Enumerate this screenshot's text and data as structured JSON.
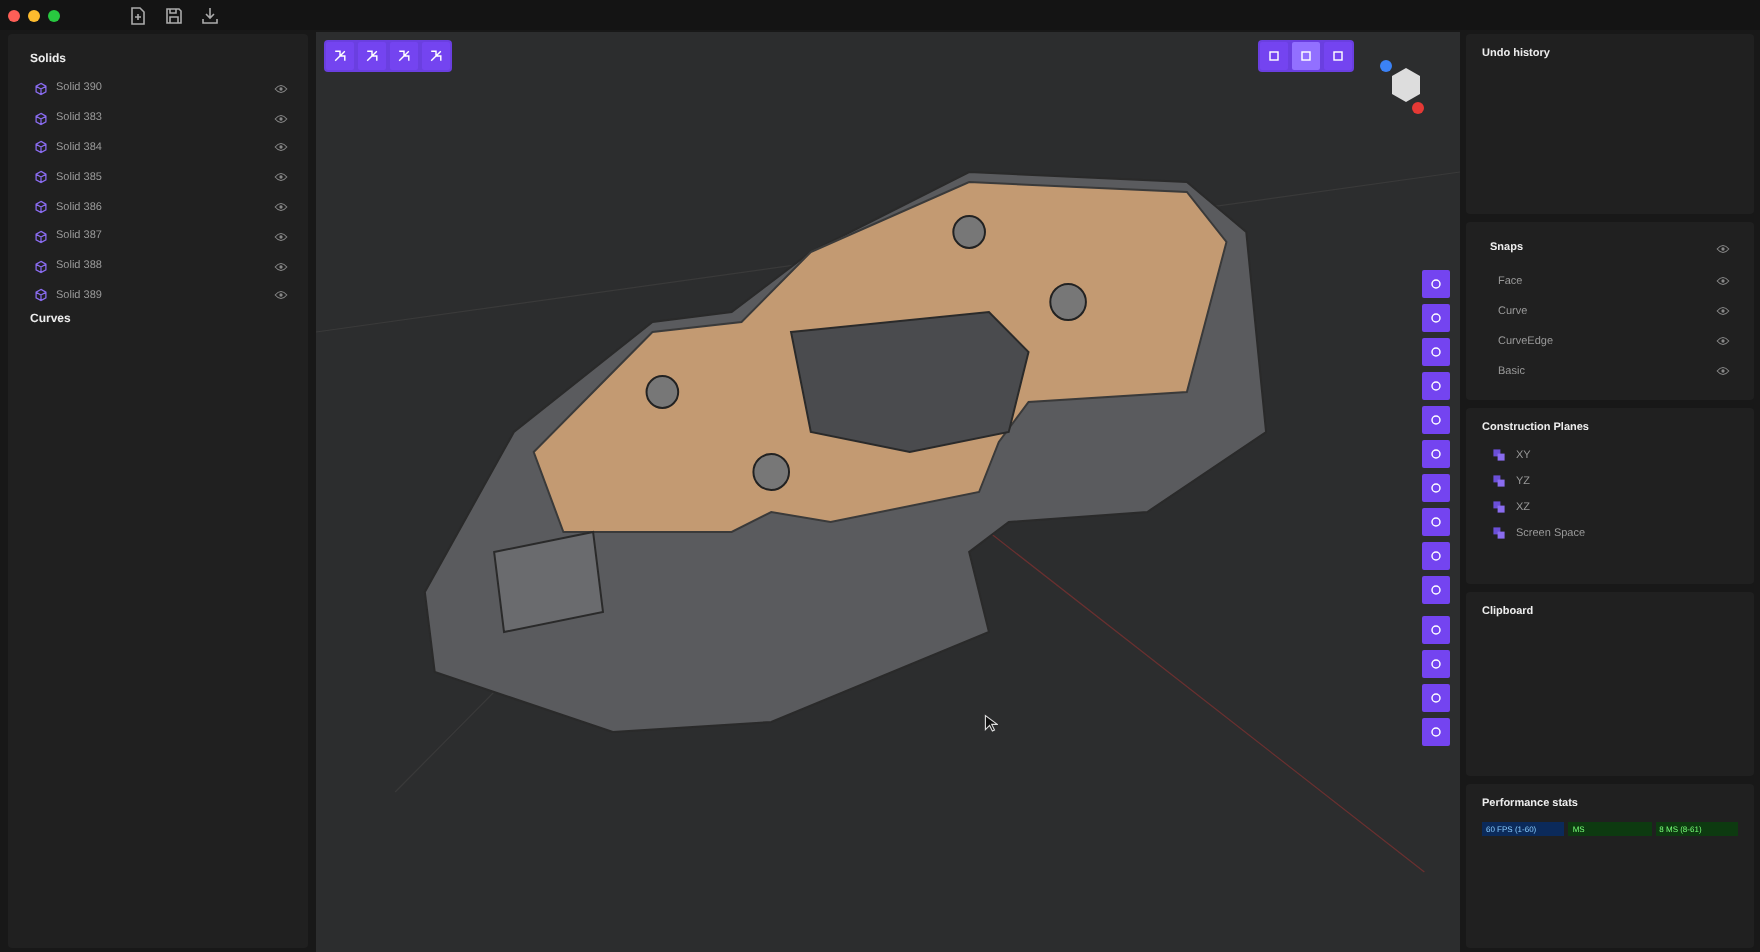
{
  "sidebar": {
    "sections": [
      {
        "title": "Solids",
        "items": [
          {
            "label": "Solid 390"
          },
          {
            "label": "Solid 383"
          },
          {
            "label": "Solid 384"
          },
          {
            "label": "Solid 385"
          },
          {
            "label": "Solid 386"
          },
          {
            "label": "Solid 387"
          },
          {
            "label": "Solid 388"
          },
          {
            "label": "Solid 389"
          }
        ]
      },
      {
        "title": "Curves"
      }
    ]
  },
  "view_modes": [
    {
      "selected": false
    },
    {
      "selected": true
    },
    {
      "selected": false
    }
  ],
  "right_panel": {
    "undo_history": {
      "title": "Undo history"
    },
    "snaps": {
      "title": "Snaps",
      "items": [
        {
          "label": "Face"
        },
        {
          "label": "Curve"
        },
        {
          "label": "CurveEdge"
        },
        {
          "label": "Basic"
        }
      ]
    },
    "construction_planes": {
      "title": "Construction Planes",
      "items": [
        {
          "label": "XY"
        },
        {
          "label": "YZ"
        },
        {
          "label": "XZ"
        },
        {
          "label": "Screen Space"
        }
      ]
    },
    "clipboard": {
      "title": "Clipboard"
    },
    "performance": {
      "title": "Performance stats",
      "meters": [
        {
          "label": "60 FPS (1-60)",
          "color": "#0b2a5a"
        },
        {
          "label": "MS",
          "color": "#0d3a10"
        },
        {
          "label": "8 MS (8-61)",
          "color": "#0d3a10"
        }
      ]
    }
  }
}
